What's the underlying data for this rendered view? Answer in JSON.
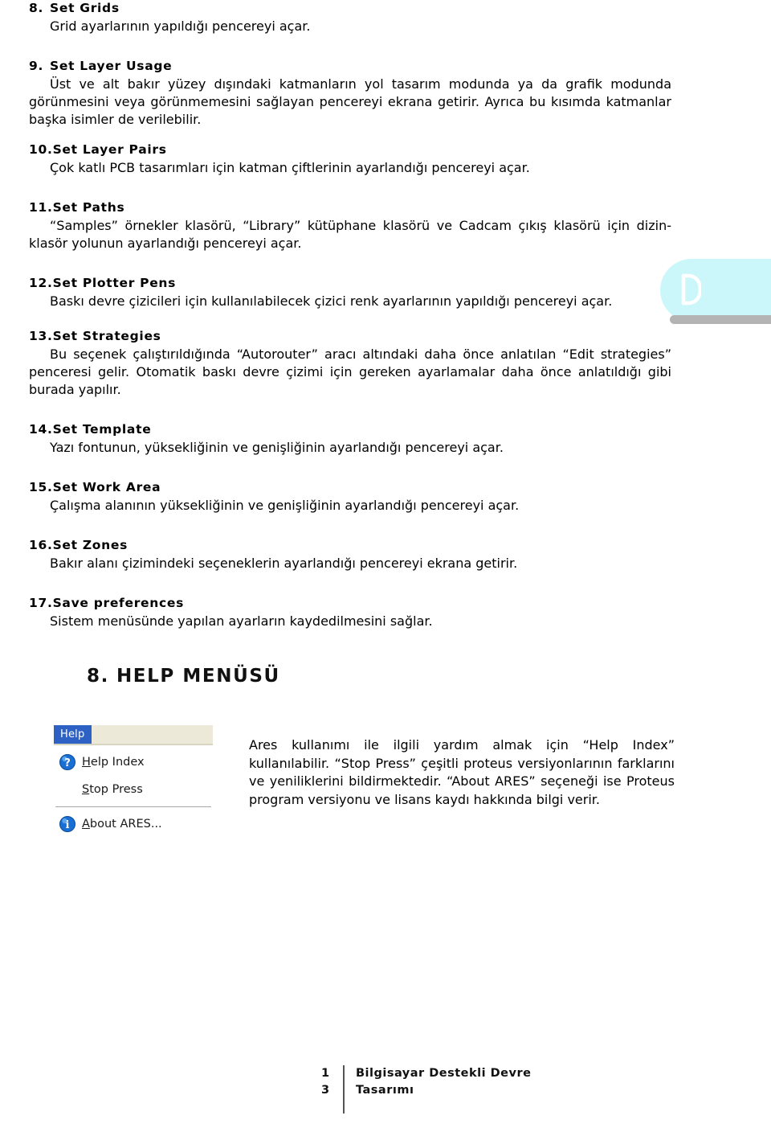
{
  "sections": [
    {
      "number": "8.",
      "title": "Set Grids",
      "body": "Grid ayarlarının yapıldığı pencereyi açar."
    },
    {
      "number": "9.",
      "title": "Set Layer Usage",
      "body": "Üst ve alt bakır yüzey dışındaki katmanların yol tasarım modunda ya da grafik modunda görünmesini veya görünmemesini sağlayan pencereyi ekrana getirir. Ayrıca bu kısımda katmanlar başka isimler de verilebilir."
    },
    {
      "number": "10.",
      "title": "Set Layer Pairs",
      "body": "Çok katlı PCB tasarımları için katman çiftlerinin ayarlandığı pencereyi açar."
    },
    {
      "number": "11.",
      "title": "Set Paths",
      "body": "“Samples” örnekler klasörü, “Library” kütüphane klasörü ve Cadcam çıkış klasörü için dizin-klasör yolunun ayarlandığı pencereyi açar."
    },
    {
      "number": "12.",
      "title": "Set Plotter Pens",
      "body": "Baskı devre çizicileri için kullanılabilecek çizici renk ayarlarının yapıldığı pencereyi açar."
    },
    {
      "number": "13.",
      "title": "Set Strategies",
      "body": "Bu seçenek çalıştırıldığında “Autorouter” aracı altındaki daha önce anlatılan “Edit strategies” penceresi gelir. Otomatik baskı devre çizimi için gereken ayarlamalar daha önce anlatıldığı gibi burada yapılır."
    },
    {
      "number": "14.",
      "title": "Set Template",
      "body": "Yazı fontunun, yüksekliğinin ve genişliğinin ayarlandığı pencereyi açar."
    },
    {
      "number": "15.",
      "title": "Set Work Area",
      "body": "Çalışma alanının yüksekliğinin ve genişliğinin ayarlandığı pencereyi açar."
    },
    {
      "number": "16.",
      "title": "Set Zones",
      "body": "Bakır alanı çizimindeki seçeneklerin ayarlandığı pencereyi ekrana getirir."
    },
    {
      "number": "17.",
      "title": "Save preferences",
      "body": "Sistem menüsünde yapılan ayarların kaydedilmesini sağlar."
    }
  ],
  "chapter": {
    "number": "8.",
    "title": "HELP MENÜSÜ"
  },
  "help_menu": {
    "titlebar_label": "Help",
    "items": [
      {
        "icon": "question-mark-icon",
        "mnemonic": "H",
        "rest": "elp Index"
      },
      {
        "icon": "none",
        "mnemonic": "S",
        "rest": "top Press"
      },
      {
        "icon": "info-icon",
        "mnemonic": "A",
        "rest": "bout ARES..."
      }
    ]
  },
  "help_paragraph": "Ares kullanımı ile ilgili yardım almak için “Help Index” kullanılabilir. “Stop Press” çeşitli proteus versiyonlarının farklarını ve yeniliklerini bildirmektedir. “About ARES” seçeneği ise Proteus program versiyonu ve lisans kaydı hakkında bilgi verir.",
  "footer": {
    "page_digit_top": "1",
    "page_digit_bottom": "3",
    "title_line1": "Bilgisayar Destekli Devre",
    "title_line2": "Tasarımı"
  },
  "colors": {
    "watermark_fill": "#ccf7fa",
    "watermark_shadow": "#b4b4b4",
    "menu_highlight": "#2d62c4",
    "menu_titlebar": "#ece9d8",
    "icon_blue": "#1a6fd4"
  }
}
